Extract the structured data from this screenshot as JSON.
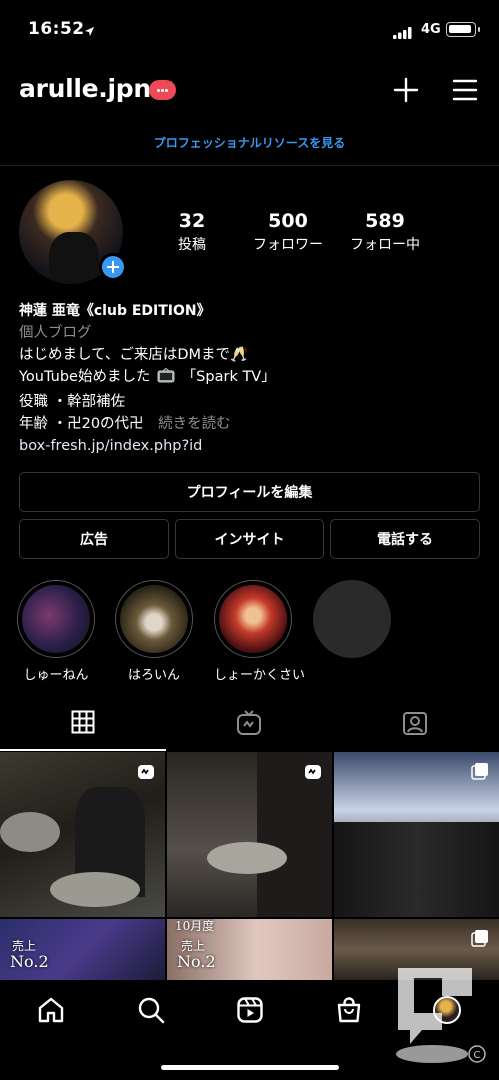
{
  "status_bar": {
    "time": "16:52",
    "network": "4G"
  },
  "header": {
    "username": "arulle.jpn",
    "pro_link": "プロフェッショナルリソースを見る"
  },
  "stats": [
    {
      "num": "32",
      "label": "投稿"
    },
    {
      "num": "500",
      "label": "フォロワー"
    },
    {
      "num": "589",
      "label": "フォロー中"
    }
  ],
  "bio": {
    "name": "神蓮 亜竜《club EDITION》",
    "category": "個人ブログ",
    "line1": "はじめまして、ご来店はDMまで🥂",
    "line2a": "YouTube始めました",
    "line2b": "「Spark TV」",
    "line3": "役職 ・幹部補佐",
    "line4": "年齢 ・卍20の代卍",
    "more": "続きを読む",
    "link": "box-fresh.jp/index.php?id"
  },
  "buttons": {
    "edit_profile": "プロフィールを編集",
    "ads": "広告",
    "insights": "インサイト",
    "call": "電話する"
  },
  "highlights": [
    {
      "label": "しゅーねん"
    },
    {
      "label": "はろいん"
    },
    {
      "label": "しょーかくさい"
    }
  ],
  "grid_overlays": {
    "cell4_rank": "No.2",
    "cell4_top": "売上",
    "cell5_month": "10月度",
    "cell5_top": "売上",
    "cell5_rank": "No.2"
  },
  "colors": {
    "accent": "#3897f0",
    "badge": "#ed4956"
  }
}
